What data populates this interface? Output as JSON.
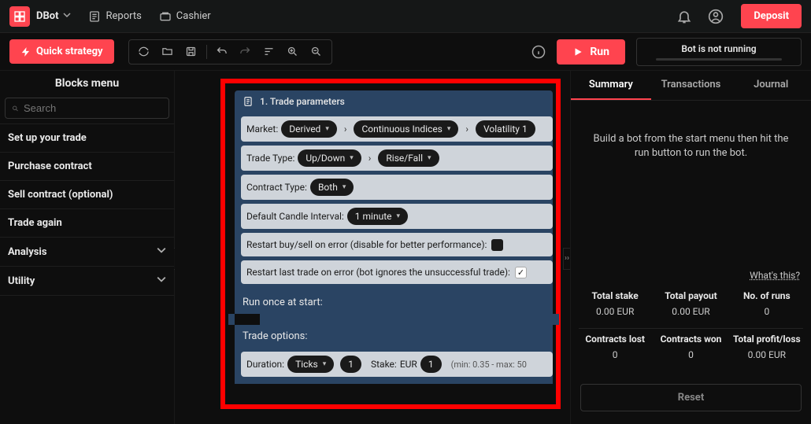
{
  "header": {
    "app_name": "DBot",
    "reports": "Reports",
    "cashier": "Cashier",
    "deposit": "Deposit"
  },
  "toolbar": {
    "quick_strategy": "Quick strategy",
    "run": "Run",
    "bot_status": "Bot is not running"
  },
  "sidebar": {
    "title": "Blocks menu",
    "search_placeholder": "Search",
    "items": [
      {
        "label": "Set up your trade",
        "expandable": false
      },
      {
        "label": "Purchase contract",
        "expandable": false
      },
      {
        "label": "Sell contract (optional)",
        "expandable": false
      },
      {
        "label": "Trade again",
        "expandable": false
      },
      {
        "label": "Analysis",
        "expandable": true
      },
      {
        "label": "Utility",
        "expandable": true
      }
    ]
  },
  "block": {
    "title": "1. Trade parameters",
    "market_label": "Market:",
    "market_val1": "Derived",
    "market_val2": "Continuous Indices",
    "market_val3": "Volatility 1",
    "tradetype_label": "Trade Type:",
    "tradetype_val1": "Up/Down",
    "tradetype_val2": "Rise/Fall",
    "contracttype_label": "Contract Type:",
    "contracttype_val": "Both",
    "candle_label": "Default Candle Interval:",
    "candle_val": "1 minute",
    "restart_buy_label": "Restart buy/sell on error (disable for better performance):",
    "restart_last_label": "Restart last trade on error (bot ignores the unsuccessful trade):",
    "run_once": "Run once at start:",
    "trade_options": "Trade options:",
    "duration_label": "Duration:",
    "duration_unit": "Ticks",
    "duration_val": "1",
    "stake_label": "Stake:",
    "stake_currency": "EUR",
    "stake_val": "1",
    "stake_hint": "(min: 0.35 - max: 50"
  },
  "rpanel": {
    "tabs": {
      "summary": "Summary",
      "transactions": "Transactions",
      "journal": "Journal"
    },
    "message": "Build a bot from the start menu then hit the run button to run the bot.",
    "whats_this": "What's this?",
    "stats": {
      "total_stake_label": "Total stake",
      "total_stake_val": "0.00 EUR",
      "total_payout_label": "Total payout",
      "total_payout_val": "0.00 EUR",
      "runs_label": "No. of runs",
      "runs_val": "0",
      "lost_label": "Contracts lost",
      "lost_val": "0",
      "won_label": "Contracts won",
      "won_val": "0",
      "pl_label": "Total profit/loss",
      "pl_val": "0.00 EUR"
    },
    "reset": "Reset"
  }
}
